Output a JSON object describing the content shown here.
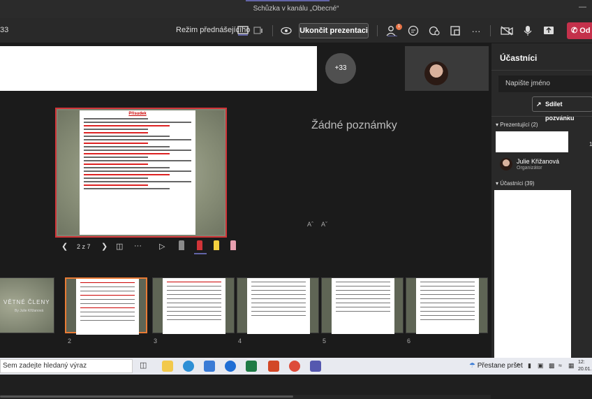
{
  "window": {
    "title": "Schůzka v kanálu „Obecné“"
  },
  "toolbar": {
    "timer": "33",
    "presenter_mode_label": "Režim přednášejícího",
    "end_presentation_label": "Ukončit prezentaci",
    "participants_badge": "1",
    "leave_label": "Od"
  },
  "stage": {
    "more_participants": "+33",
    "no_notes": "Žádné poznámky",
    "font_increase": "Aˆ",
    "font_decrease": "Aˇ",
    "slide_counter": "2 z 7",
    "current_slide_title": "Přísudek",
    "thumbnail_cover_text": "VĚTNÉ ČLENY",
    "thumbnail_cover_sub": "By Julie Křižanová",
    "thumb_numbers": [
      "2",
      "3",
      "4",
      "5",
      "6"
    ]
  },
  "panel": {
    "title": "Účastníci",
    "search_placeholder": "Napište jméno",
    "share_label": "Sdílet pozvánku",
    "presenters_label": "Prezentující (2)",
    "presenter_count_badge": "1",
    "presenter_name": "Julie Křižanová",
    "presenter_role": "Organizátor",
    "attendees_label": "Účastníci (39)"
  },
  "taskbar": {
    "search_placeholder": "Sem zadejte hledaný výraz",
    "weather": "Přestane pršet",
    "time": "12:",
    "date": "20.01."
  },
  "colors": {
    "accent": "#6264a7",
    "leave": "#c4314b",
    "active_thumb": "#e97b35",
    "slide_border": "#d13438"
  }
}
